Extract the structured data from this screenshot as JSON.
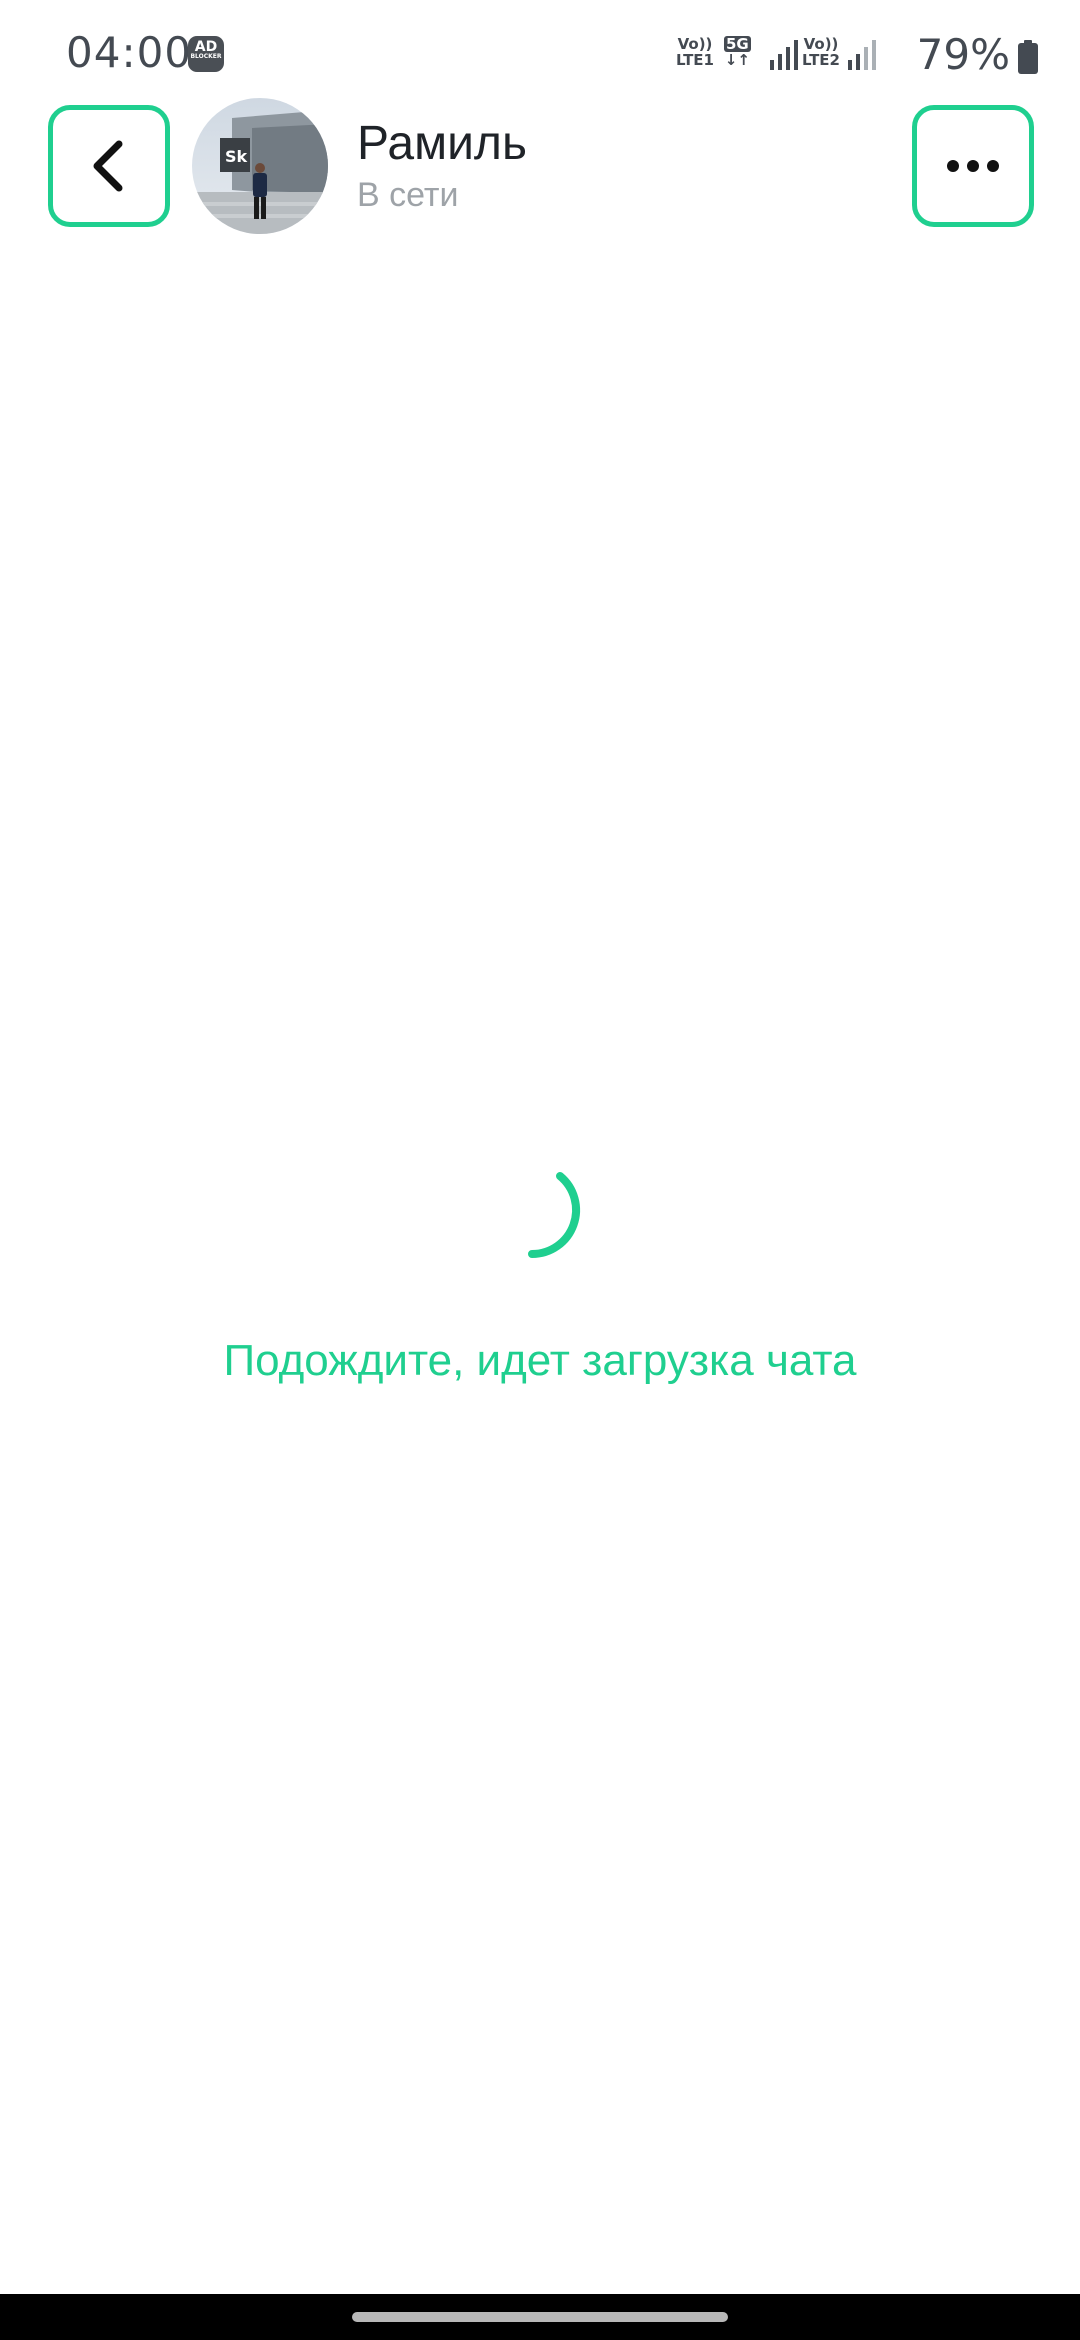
{
  "status_bar": {
    "time": "04:00",
    "adblock_label": "AD",
    "adblock_sub": "BLOCKER",
    "sim1_top": "Vo))",
    "sim1_bottom": "LTE1",
    "network_type": "5G",
    "sim2_top": "Vo))",
    "sim2_bottom": "LTE2",
    "battery_percent": "79%",
    "icons": [
      "adblocker-icon",
      "signal-icon",
      "battery-icon"
    ]
  },
  "header": {
    "contact_name": "Рамиль",
    "contact_status": "В сети",
    "back_icon": "chevron-left-icon",
    "menu_icon": "more-horizontal-icon"
  },
  "loading": {
    "message": "Подождите, идет загрузка чата"
  },
  "colors": {
    "accent": "#1fcf8f",
    "title": "#1f2328",
    "subtitle": "#9ea3a8",
    "background": "#ffffff"
  }
}
